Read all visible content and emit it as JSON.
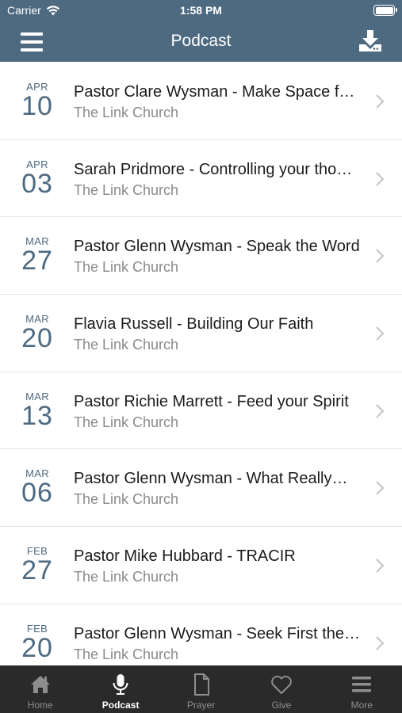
{
  "status_bar": {
    "carrier": "Carrier",
    "time": "1:58 PM"
  },
  "header": {
    "title": "Podcast",
    "menu_icon": "hamburger-menu-icon",
    "download_icon": "download-icon"
  },
  "episodes": [
    {
      "month": "APR",
      "day": "10",
      "title": "Pastor Clare Wysman - Make Space f…",
      "subtitle": "The Link Church"
    },
    {
      "month": "APR",
      "day": "03",
      "title": "Sarah Pridmore - Controlling your tho…",
      "subtitle": "The Link Church"
    },
    {
      "month": "MAR",
      "day": "27",
      "title": "Pastor Glenn Wysman - Speak the Word",
      "subtitle": "The Link Church"
    },
    {
      "month": "MAR",
      "day": "20",
      "title": "Flavia Russell - Building Our Faith",
      "subtitle": "The Link Church"
    },
    {
      "month": "MAR",
      "day": "13",
      "title": "Pastor Richie Marrett - Feed your Spirit",
      "subtitle": "The Link Church"
    },
    {
      "month": "MAR",
      "day": "06",
      "title": "Pastor Glenn Wysman - What Really…",
      "subtitle": "The Link Church"
    },
    {
      "month": "FEB",
      "day": "27",
      "title": "Pastor Mike Hubbard - TRACIR",
      "subtitle": "The Link Church"
    },
    {
      "month": "FEB",
      "day": "20",
      "title": "Pastor Glenn Wysman - Seek First the…",
      "subtitle": "The Link Church"
    }
  ],
  "tabs": [
    {
      "label": "Home",
      "icon": "home-icon"
    },
    {
      "label": "Podcast",
      "icon": "microphone-icon"
    },
    {
      "label": "Prayer",
      "icon": "document-icon"
    },
    {
      "label": "Give",
      "icon": "heart-icon"
    },
    {
      "label": "More",
      "icon": "menu-lines-icon"
    }
  ],
  "colors": {
    "header": "#4e6a81",
    "tab_bar": "#2a2a2a",
    "date": "#4e6a81",
    "active_tab": "#ffffff",
    "inactive_tab": "#8e8e8e"
  }
}
